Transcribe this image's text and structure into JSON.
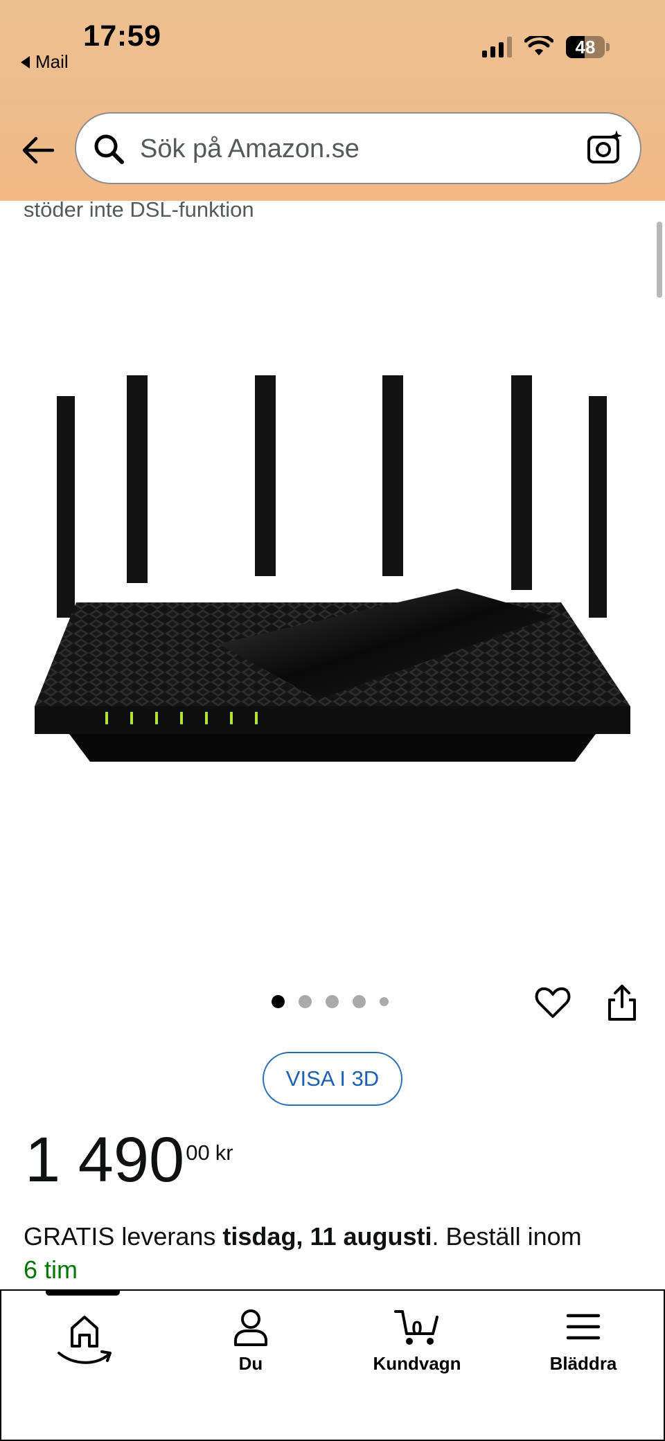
{
  "status_bar": {
    "time": "17:59",
    "back_app": "Mail",
    "battery": "48",
    "battery_level": 0.48
  },
  "search": {
    "placeholder": "Sök på Amazon.se"
  },
  "product": {
    "description_cut": "stöder inte DSL-funktion",
    "image_pager": {
      "count": 5,
      "active_index": 0
    },
    "view_3d_label": "VISA I 3D",
    "price_whole": "1 490",
    "price_fraction": "00",
    "currency": "kr",
    "delivery_prefix": "GRATIS leverans ",
    "delivery_date": "tisdag, 11 augusti",
    "delivery_suffix": ". Beställ inom",
    "delivery_time_left": "6 tim"
  },
  "icons": {
    "back": "back-arrow-icon",
    "search": "search-icon",
    "camera": "camera-search-icon",
    "wishlist": "heart-icon",
    "share": "share-icon"
  },
  "bottom_nav": {
    "items": [
      {
        "id": "home",
        "label": "",
        "icon": "home-icon"
      },
      {
        "id": "you",
        "label": "Du",
        "icon": "user-icon"
      },
      {
        "id": "cart",
        "label": "Kundvagn",
        "icon": "cart-icon",
        "count": "0"
      },
      {
        "id": "browse",
        "label": "Bläddra",
        "icon": "menu-icon"
      }
    ],
    "active": "home"
  },
  "colors": {
    "header_bg": "#efbd8c",
    "link_blue": "#1d5fb0",
    "delivery_green": "#007600",
    "text": "#0f1111"
  }
}
